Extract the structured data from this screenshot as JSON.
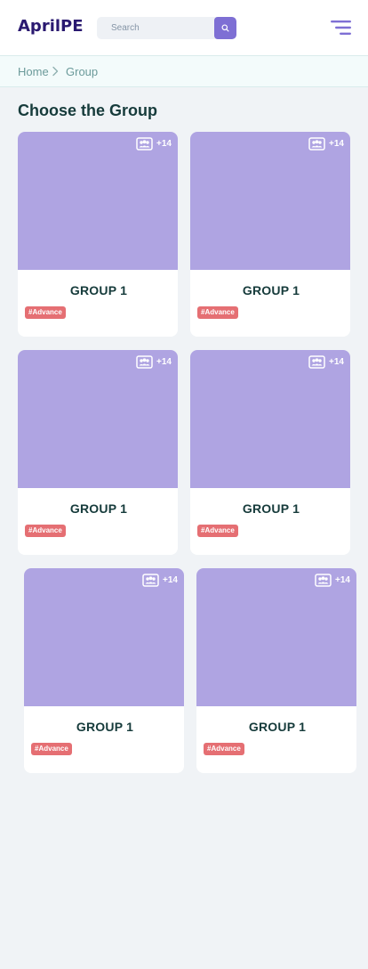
{
  "header": {
    "logo": "AprilPE",
    "search": {
      "placeholder": "Search",
      "value": ""
    },
    "icons": {
      "search_button": "search-icon",
      "menu": "menu-icon"
    }
  },
  "breadcrumb": {
    "items": [
      "Home",
      "Group"
    ],
    "separator_icon": "chevron-right-icon"
  },
  "page": {
    "title": "Choose the Group"
  },
  "groups": [
    {
      "title": "GROUP 1",
      "member_count": "+14",
      "tag": "#Advance",
      "member_icon": "group-icon"
    },
    {
      "title": "GROUP 1",
      "member_count": "+14",
      "tag": "#Advance",
      "member_icon": "group-icon"
    },
    {
      "title": "GROUP 1",
      "member_count": "+14",
      "tag": "#Advance",
      "member_icon": "group-icon"
    },
    {
      "title": "GROUP 1",
      "member_count": "+14",
      "tag": "#Advance",
      "member_icon": "group-icon"
    },
    {
      "title": "GROUP 1",
      "member_count": "+14",
      "tag": "#Advance",
      "member_icon": "group-icon"
    },
    {
      "title": "GROUP 1",
      "member_count": "+14",
      "tag": "#Advance",
      "member_icon": "group-icon"
    }
  ],
  "colors": {
    "brand": "#2a1970",
    "accent": "#7e6fd4",
    "card_cover": "#afa4e2",
    "tag": "#e56f73",
    "title_text": "#163b3b",
    "breadcrumb_text": "#6b9a9a",
    "page_background": "#f0f3f6"
  }
}
